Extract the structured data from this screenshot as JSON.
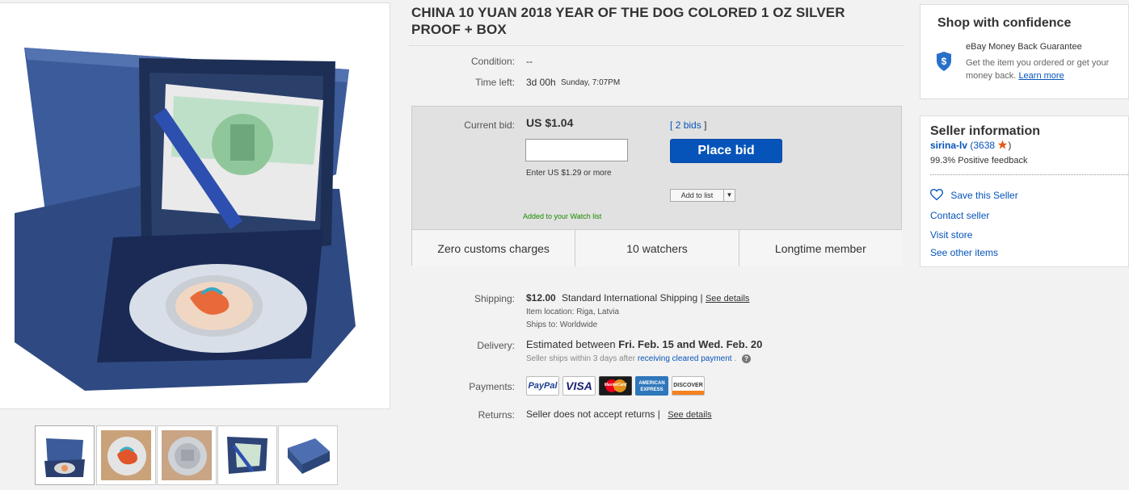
{
  "listing": {
    "title": "CHINA 10 YUAN 2018 YEAR OF THE DOG COLORED 1 OZ SILVER PROOF + BOX",
    "condition_label": "Condition:",
    "condition_value": "--",
    "time_left_label": "Time left:",
    "time_left_value": "3d 00h",
    "time_left_end": "Sunday, 7:07PM"
  },
  "bid": {
    "current_bid_label": "Current bid:",
    "current_bid_value": "US $1.04",
    "bids_open": "[",
    "bids_link": "2 bids",
    "bids_close": "]",
    "input_value": "",
    "hint": "Enter US $1.29 or more",
    "place_bid_label": "Place bid",
    "add_to_list_label": "Add to list",
    "watch_msg": "Added to your Watch list",
    "features": [
      "Zero customs charges",
      "10 watchers",
      "Longtime member"
    ]
  },
  "shipping": {
    "label": "Shipping:",
    "price": "$12.00",
    "method": "Standard International Shipping |",
    "see_details": "See details",
    "item_location": "Item location:  Riga, Latvia",
    "ships_to": "Ships to:  Worldwide"
  },
  "delivery": {
    "label": "Delivery:",
    "prefix": "Estimated between",
    "dates": "Fri. Feb. 15 and Wed. Feb. 20",
    "note_prefix": "Seller ships within 3 days after",
    "note_link": "receiving cleared payment",
    "note_suffix": "."
  },
  "payments": {
    "label": "Payments:",
    "methods": [
      "PayPal",
      "VISA",
      "MasterCard",
      "AMERICAN EXPRESS",
      "DISCOVER"
    ]
  },
  "returns": {
    "label": "Returns:",
    "value": "Seller does not accept returns |",
    "see_details": "See details"
  },
  "confidence": {
    "heading": "Shop with confidence",
    "guarantee_title": "eBay Money Back Guarantee",
    "guarantee_text": "Get the item you ordered or get your money back.",
    "learn_more": "Learn more"
  },
  "seller": {
    "heading": "Seller information",
    "name": "sirina-lv",
    "score_open": "(",
    "score": "3638",
    "score_close": ")",
    "feedback": "99.3% Positive feedback",
    "save_seller": "Save this Seller",
    "contact": "Contact seller",
    "visit_store": "Visit store",
    "other_items": "See other items"
  },
  "colors": {
    "link": "#0654ba",
    "button": "#0654ba",
    "green": "#1a8a00",
    "star": "#e55a1a"
  },
  "icons": [
    "shield-icon",
    "heart-icon",
    "star-icon",
    "chevron-down-icon",
    "help-icon"
  ]
}
